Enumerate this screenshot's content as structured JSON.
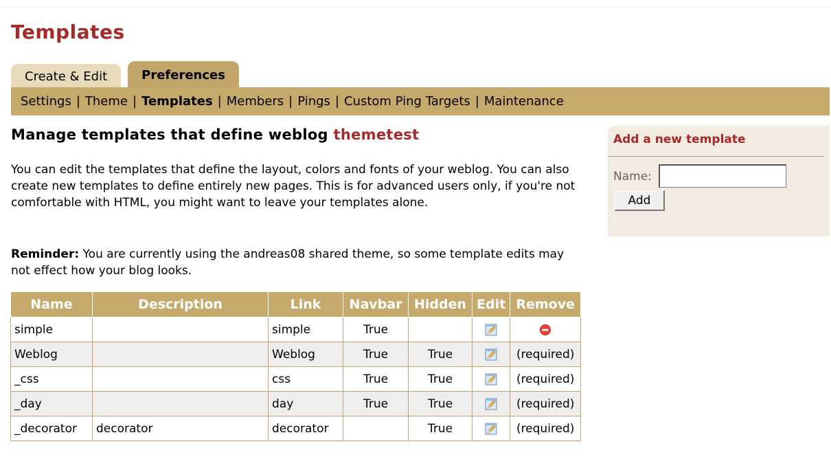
{
  "page": {
    "title": "Templates"
  },
  "tabs": [
    {
      "label": "Create & Edit",
      "active": false
    },
    {
      "label": "Preferences",
      "active": true
    }
  ],
  "subnav": {
    "items": [
      "Settings",
      "Theme",
      "Templates",
      "Members",
      "Pings",
      "Custom Ping Targets",
      "Maintenance"
    ],
    "current": "Templates",
    "separator": "|"
  },
  "heading": {
    "prefix": "Manage templates that define weblog",
    "weblog": "themetest"
  },
  "intro": "You can edit the templates that define the layout, colors and fonts of your weblog. You can also create new templates to define entirely new pages. This is for advanced users only, if you're not comfortable with HTML, you might want to leave your templates alone.",
  "reminder": {
    "label": "Reminder:",
    "text": " You are currently using the andreas08 shared theme, so some template edits may not effect how your blog looks."
  },
  "table": {
    "columns": [
      "Name",
      "Description",
      "Link",
      "Navbar",
      "Hidden",
      "Edit",
      "Remove"
    ],
    "rows": [
      {
        "name": "simple",
        "description": "",
        "link": "simple",
        "navbar": "True",
        "hidden": "",
        "edit_icon": "edit-pencil-icon",
        "remove": "",
        "remove_icon": "remove-icon"
      },
      {
        "name": "Weblog",
        "description": "",
        "link": "Weblog",
        "navbar": "True",
        "hidden": "True",
        "edit_icon": "edit-pencil-icon",
        "remove": "(required)"
      },
      {
        "name": "_css",
        "description": "",
        "link": "css",
        "navbar": "True",
        "hidden": "True",
        "edit_icon": "edit-pencil-icon",
        "remove": "(required)"
      },
      {
        "name": "_day",
        "description": "",
        "link": "day",
        "navbar": "True",
        "hidden": "True",
        "edit_icon": "edit-pencil-icon",
        "remove": "(required)"
      },
      {
        "name": "_decorator",
        "description": "decorator",
        "link": "decorator",
        "navbar": "",
        "hidden": "True",
        "edit_icon": "edit-pencil-icon",
        "remove": "(required)"
      }
    ]
  },
  "sidebar": {
    "title": "Add a new template",
    "name_label": "Name:",
    "name_value": "",
    "add_button": "Add"
  },
  "colors": {
    "accent": "#a52a2a",
    "tan": "#c6aa6c",
    "tab_inactive": "#e7dbbb",
    "sidebar_bg": "#f1ebe1"
  }
}
